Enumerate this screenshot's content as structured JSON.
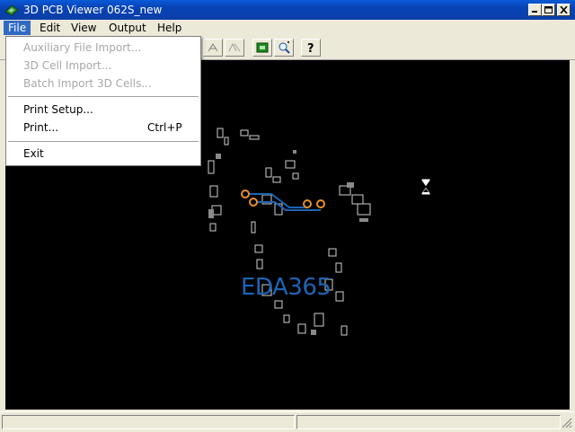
{
  "window": {
    "title": "3D PCB Viewer  062S_new"
  },
  "menubar": {
    "items": [
      {
        "label": "File"
      },
      {
        "label": "Edit"
      },
      {
        "label": "View"
      },
      {
        "label": "Output"
      },
      {
        "label": "Help"
      }
    ]
  },
  "file_menu": {
    "items": [
      {
        "label": "Auxiliary File Import...",
        "enabled": false
      },
      {
        "label": "3D Cell Import...",
        "enabled": false
      },
      {
        "label": "Batch Import 3D Cells...",
        "enabled": false
      },
      {
        "label": "Print Setup...",
        "enabled": true
      },
      {
        "label": "Print...",
        "shortcut": "Ctrl+P",
        "enabled": true
      },
      {
        "label": "Exit",
        "enabled": true
      }
    ]
  },
  "watermark": {
    "text": "EDA365"
  },
  "colors": {
    "titlebar": "#0a4cc4",
    "menu_highlight": "#316ac5",
    "canvas_background": "#000000",
    "watermark": "#1d64b4",
    "disabled_text": "#a7a7a7"
  },
  "icons": {
    "app": "pcb-board-icon",
    "toolbar": [
      "rotate-icon",
      "rotate-disabled-icon",
      "green-board-icon",
      "zoom-fit-icon",
      "help-icon"
    ],
    "cursor": "hourglass-icon"
  }
}
